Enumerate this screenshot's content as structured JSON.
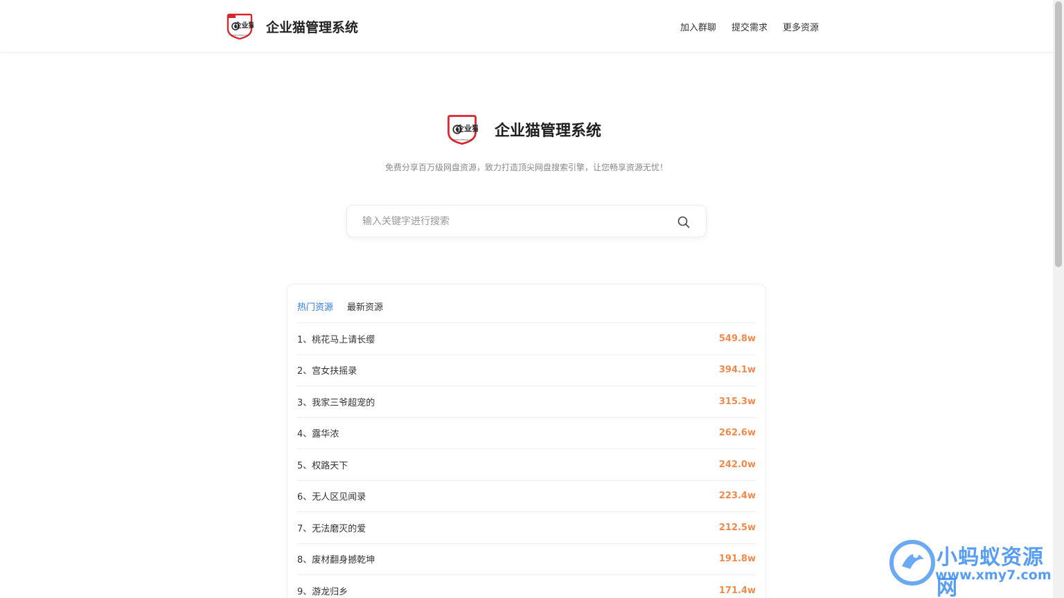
{
  "app": {
    "title": "企业猫管理系统",
    "logo_text": "企业猫",
    "logo_subtext": "WWW.QIYEMAO.CN"
  },
  "nav": {
    "items": [
      {
        "label": "加入群聊"
      },
      {
        "label": "提交需求"
      },
      {
        "label": "更多资源"
      }
    ]
  },
  "hero": {
    "title": "企业猫管理系统",
    "subtitle": "免费分享百万级网盘资源，致力打造顶尖网盘搜索引擎，让您畅享资源无忧！"
  },
  "search": {
    "placeholder": "输入关键字进行搜索",
    "value": "",
    "icon": "search-icon"
  },
  "tabs": [
    {
      "label": "热门资源",
      "active": true
    },
    {
      "label": "最新资源",
      "active": false
    }
  ],
  "list": [
    {
      "title": "1、桃花马上请长缨",
      "count": "549.8w"
    },
    {
      "title": "2、宫女扶摇录",
      "count": "394.1w"
    },
    {
      "title": "3、我家三爷超宠的",
      "count": "315.3w"
    },
    {
      "title": "4、露华浓",
      "count": "262.6w"
    },
    {
      "title": "5、权路天下",
      "count": "242.0w"
    },
    {
      "title": "6、无人区见闻录",
      "count": "223.4w"
    },
    {
      "title": "7、无法磨灭的爱",
      "count": "212.5w"
    },
    {
      "title": "8、废材翻身撼乾坤",
      "count": "191.8w"
    },
    {
      "title": "9、游龙归乡",
      "count": "171.4w"
    }
  ],
  "colors": {
    "accent": "#2f7ae5",
    "count": "#f08a4b",
    "logo_red": "#d8262e"
  },
  "watermark": {
    "line1": "小蚂蚁资源网",
    "line2": "www.xmy7.com"
  }
}
